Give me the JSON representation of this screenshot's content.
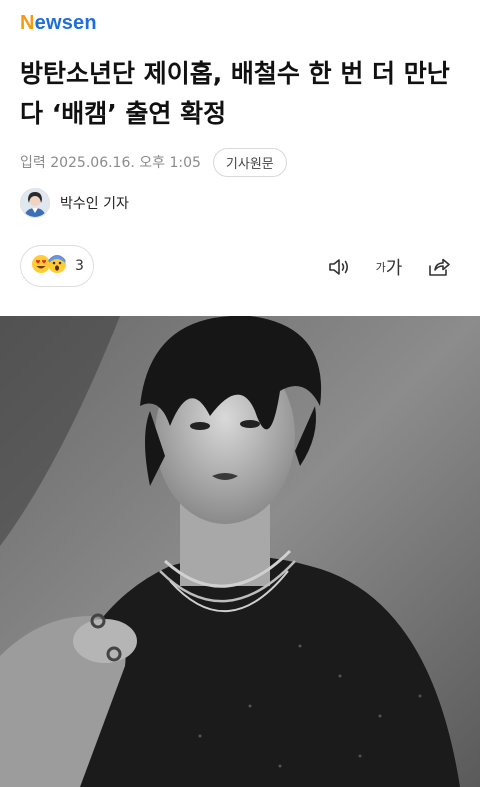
{
  "header": {
    "logo_first": "N",
    "logo_rest": "ewsen",
    "logo_colors": {
      "first": "#f39c12",
      "rest": "#1e6fd9"
    }
  },
  "article": {
    "title": "방탄소년단 제이홉, 배철수 한 번 더 만난다 ‘배캠’ 출연 확정",
    "published": "입력 2025.06.16. 오후 1:05",
    "source_button": "기사원문",
    "reporter": "박수인 기자"
  },
  "actions": {
    "reaction_count": "3",
    "reaction_icons": [
      "heart-eyes-emoji-icon",
      "shocked-emoji-icon"
    ],
    "font_size_small": "가",
    "font_size_large": "가",
    "icons": [
      "speaker-icon",
      "font-size-icon",
      "share-icon"
    ]
  },
  "photo": {
    "icon": "portrait-photo",
    "tone": "black-and-white"
  }
}
